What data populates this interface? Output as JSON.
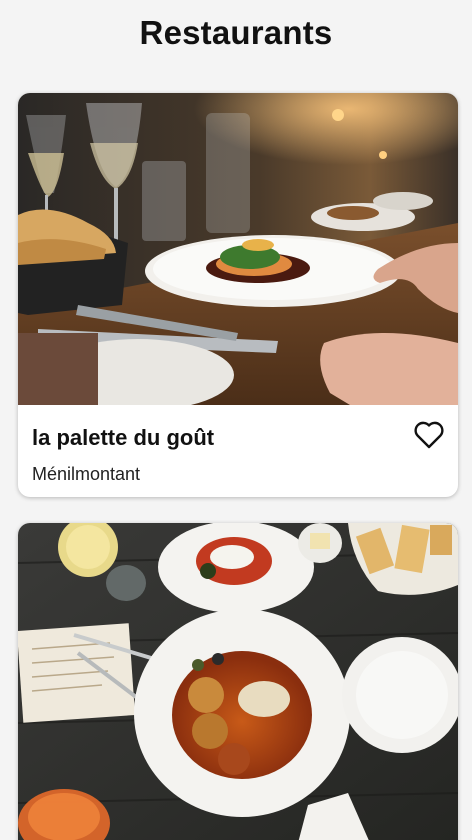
{
  "header": {
    "title": "Restaurants"
  },
  "restaurants": [
    {
      "name": "la palette du goût",
      "district": "Ménilmontant",
      "favorite": false,
      "favorite_icon": "heart-outline-icon"
    },
    {
      "name": "",
      "district": "",
      "favorite": false
    }
  ]
}
